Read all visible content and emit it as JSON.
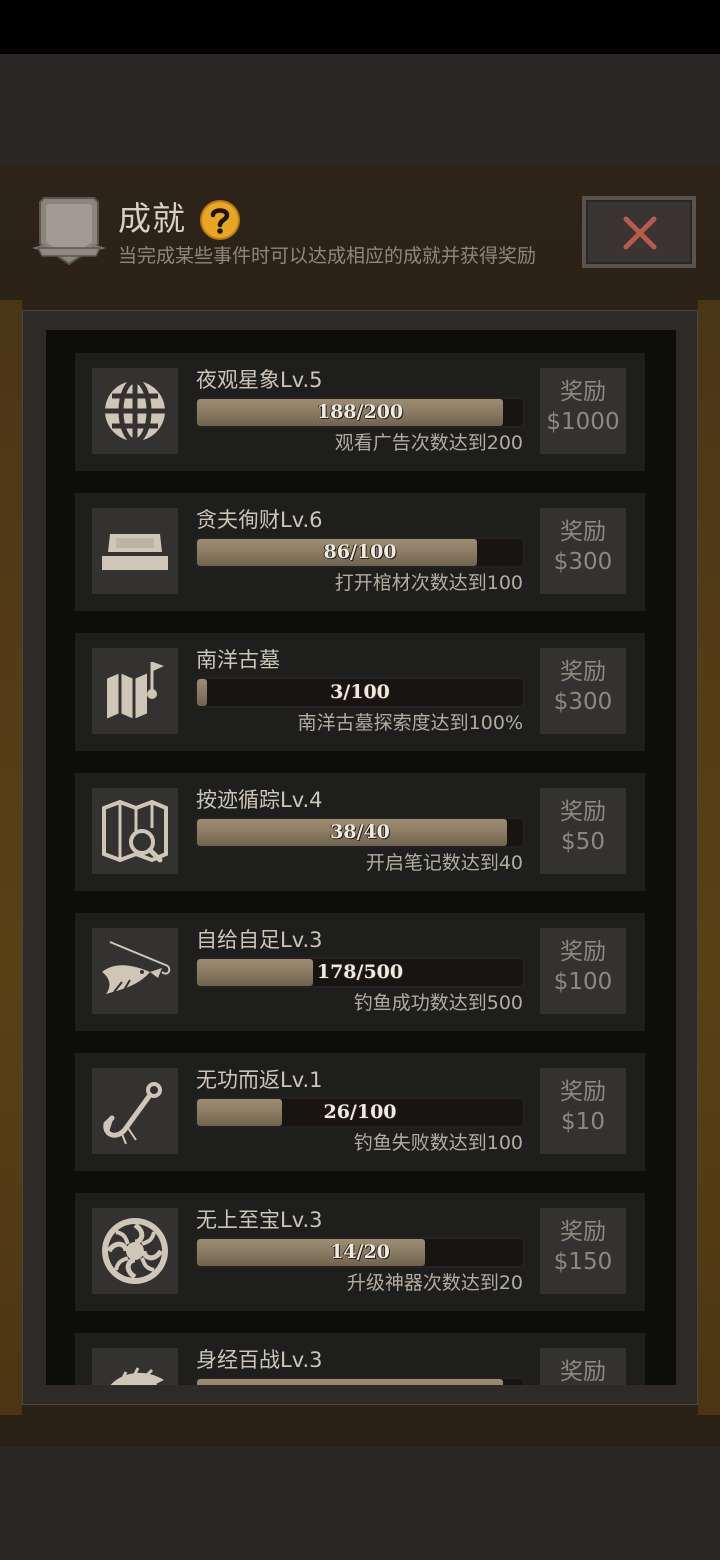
{
  "header": {
    "title": "成就",
    "subtitle": "当完成某些事件时可以达成相应的成就并获得奖励",
    "help_icon": "question-mark-icon",
    "close_icon": "close-x-icon"
  },
  "colors": {
    "accent_gold": "#e8a623",
    "close_red": "#b85a4a",
    "progress_fill": "#8a7b62",
    "card_bg": "#1e1e1d"
  },
  "achievements": [
    {
      "icon": "globe-icon",
      "title": "夜观星象Lv.5",
      "current": 188,
      "target": 200,
      "progress_text": "188/200",
      "description": "观看广告次数达到200",
      "reward_label": "奖励",
      "reward_amount": "$1000"
    },
    {
      "icon": "coffin-icon",
      "title": "贪夫徇财Lv.6",
      "current": 86,
      "target": 100,
      "progress_text": "86/100",
      "description": "打开棺材次数达到100",
      "reward_label": "奖励",
      "reward_amount": "$300"
    },
    {
      "icon": "map-flag-icon",
      "title": "南洋古墓",
      "current": 3,
      "target": 100,
      "progress_text": "3/100",
      "description": "南洋古墓探索度达到100%",
      "reward_label": "奖励",
      "reward_amount": "$300"
    },
    {
      "icon": "map-search-icon",
      "title": "按迹循踪Lv.4",
      "current": 38,
      "target": 40,
      "progress_text": "38/40",
      "description": "开启笔记数达到40",
      "reward_label": "奖励",
      "reward_amount": "$50"
    },
    {
      "icon": "fishing-icon",
      "title": "自给自足Lv.3",
      "current": 178,
      "target": 500,
      "progress_text": "178/500",
      "description": "钓鱼成功数达到500",
      "reward_label": "奖励",
      "reward_amount": "$100"
    },
    {
      "icon": "fish-hook-icon",
      "title": "无功而返Lv.1",
      "current": 26,
      "target": 100,
      "progress_text": "26/100",
      "description": "钓鱼失败数达到100",
      "reward_label": "奖励",
      "reward_amount": "$10"
    },
    {
      "icon": "artifact-emblem-icon",
      "title": "无上至宝Lv.3",
      "current": 14,
      "target": 20,
      "progress_text": "14/20",
      "description": "升级神器次数达到20",
      "reward_label": "奖励",
      "reward_amount": "$150"
    },
    {
      "icon": "beast-icon",
      "title": "身经百战Lv.3",
      "current": 47,
      "target": 50,
      "progress_text": "",
      "description": "",
      "reward_label": "奖励",
      "reward_amount": ""
    }
  ]
}
